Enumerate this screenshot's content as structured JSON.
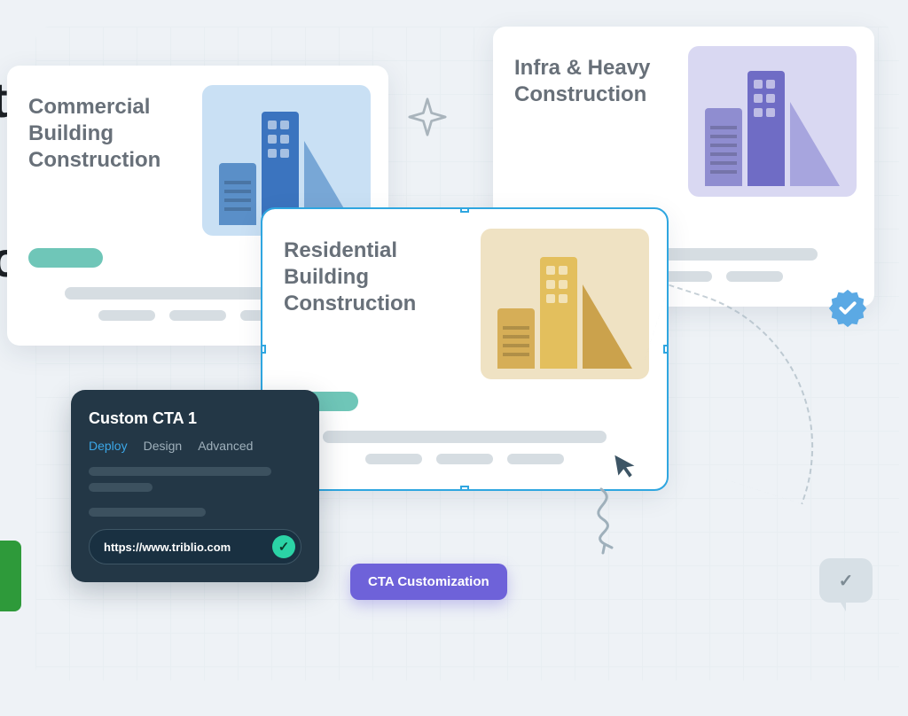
{
  "cards": {
    "commercial": {
      "title": "Commercial Building Construction"
    },
    "infra": {
      "title": "Infra & Heavy Construction"
    },
    "residential": {
      "title": "Residential Building Construction"
    }
  },
  "widget": {
    "title": "Custom CTA 1",
    "tabs": {
      "deploy": "Deploy",
      "design": "Design",
      "advanced": "Advanced"
    },
    "url": "https://www.triblio.com"
  },
  "cta_button": "CTA Customization",
  "edge": {
    "t": "t",
    "o": "o"
  }
}
